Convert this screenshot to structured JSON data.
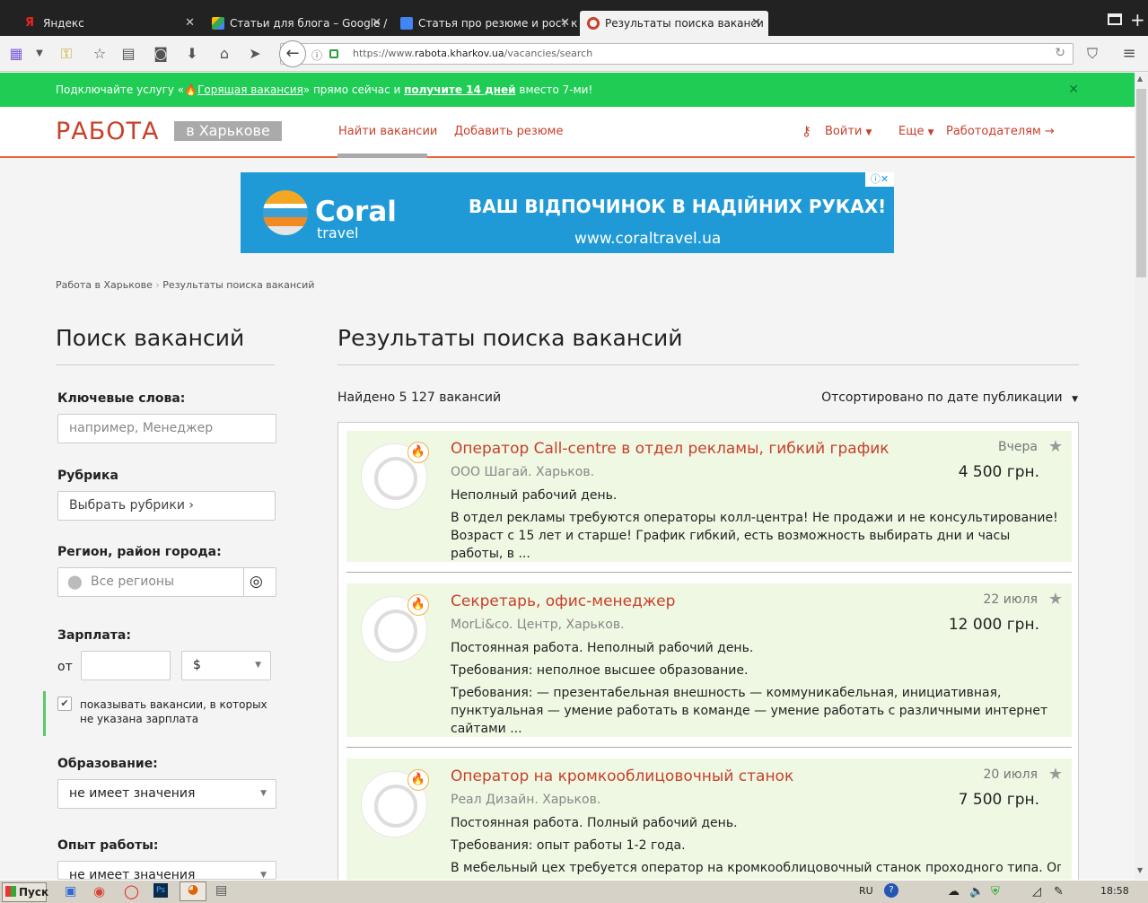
{
  "tabs": [
    {
      "label": "Яндекс",
      "icon": "yandex-icon"
    },
    {
      "label": "Статьи для блога – Google /",
      "icon": "google-drive-icon"
    },
    {
      "label": "Статья про резюме и рост к",
      "icon": "google-docs-icon"
    },
    {
      "label": "Результаты поиска ваканси",
      "icon": "rabota-icon",
      "active": true
    }
  ],
  "url": {
    "prefix": "https://www.",
    "domain": "rabota.kharkov.ua",
    "path": "/vacancies/search"
  },
  "promo": {
    "part1": "Подключайте услугу «",
    "service": "Горящая вакансия",
    "part2": "» прямо сейчас и ",
    "bold": "получите 14 дней",
    "part3": " вместо 7-ми!",
    "close": "✕"
  },
  "header": {
    "logo": "РАБОТА",
    "city": "в Харькове",
    "nav_find": "Найти вакансии",
    "nav_add": "Добавить резюме",
    "login": "Войти",
    "more": "Еще",
    "employers": "Работодателям"
  },
  "ad": {
    "brand": "Coral",
    "brand_sub": "travel",
    "slogan": "ВАШ ВІДПОЧИНОК  В НАДІЙНИХ РУКАХ!",
    "url": "www.coraltravel.ua"
  },
  "breadcrumb": {
    "home": "Работа в Харькове",
    "sep": "›",
    "current": "Результаты поиска вакансий"
  },
  "filters": {
    "title": "Поиск вакансий",
    "keywords_label": "Ключевые слова:",
    "keywords_placeholder": "например, Менеджер",
    "rubric_label": "Рубрика",
    "rubric_value": "Выбрать рубрики ›",
    "region_label": "Регион, район города:",
    "region_value": "Все регионы",
    "salary_label": "Зарплата:",
    "salary_from": "от",
    "currency": "$",
    "show_no_salary": "показывать вакансии, в которых не указана зарплата",
    "education_label": "Образование:",
    "education_value": "не имеет значения",
    "experience_label": "Опыт работы:",
    "experience_value": "не имеет значения"
  },
  "results": {
    "title": "Результаты поиска вакансий",
    "found": "Найдено 5 127 вакансий",
    "sort": "Отсортировано по дате публикации",
    "vacancies": [
      {
        "title": "Оператор Call-centre в отдел рекламы, гибкий график",
        "company": "ООО Шагай. Харьков.",
        "date": "Вчера",
        "salary": "4 500 грн.",
        "lines": [
          "Неполный рабочий день.",
          "В отдел рекламы требуются операторы колл-центра! Не продажи и не консультирование! Возраст с 15 лет и старше! График гибкий, есть возможность выбирать дни и часы работы, в ..."
        ]
      },
      {
        "title": "Секретарь, офис-менеджер",
        "company": "MorLi&co. Центр, Харьков.",
        "date": "22 июля",
        "salary": "12 000 грн.",
        "lines": [
          "Постоянная работа. Неполный рабочий день.",
          "Требования: неполное высшее образование.",
          "Требования: — презентабельная внешность — коммуникабельная, инициативная, пунктуальная — умение работать в команде — умение работать с различными интернет сайтами ..."
        ]
      },
      {
        "title": "Оператор на кромкооблицовочный станок",
        "company": "Реал Дизайн. Харьков.",
        "date": "20 июля",
        "salary": "7 500 грн.",
        "lines": [
          "Постоянная работа. Полный рабочий день.",
          "Требования: опыт работы 1-2 года.",
          "В мебельный цех требуется оператор на кромкооблицовочный станок проходного типа. Опыт"
        ]
      }
    ]
  },
  "taskbar": {
    "start": "Пуск",
    "lang": "RU",
    "time": "18:58"
  },
  "colors": {
    "accent": "#c8402a",
    "promo": "#1fcc54",
    "card_bg": "#eff8e3",
    "ad_bg": "#1f9ad6"
  }
}
